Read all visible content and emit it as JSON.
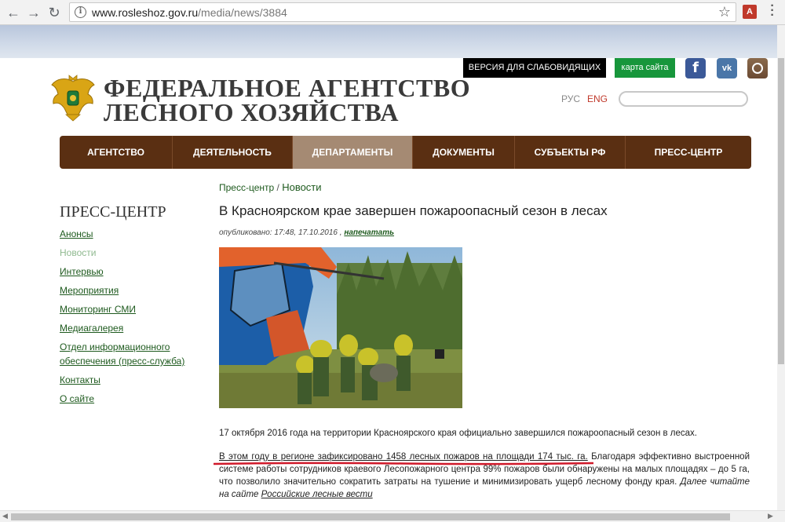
{
  "browser": {
    "url_domain": "www.rosleshoz.gov.ru",
    "url_path": "/media/news/3884",
    "back_icon": "arrow-left-icon",
    "forward_icon": "arrow-right-icon",
    "reload_icon": "reload-icon"
  },
  "header": {
    "title_line1": "ФЕДЕРАЛЬНОЕ АГЕНТСТВО",
    "title_line2": "ЛЕСНОГО ХОЗЯЙСТВА",
    "blind_version_label": "ВЕРСИЯ ДЛЯ СЛАБОВИДЯЩИХ",
    "sitemap_label": "карта сайта",
    "lang_ru": "РУС",
    "lang_en": "ENG",
    "search_placeholder": "",
    "social": [
      "facebook-icon",
      "vk-icon",
      "instagram-icon"
    ],
    "colors": {
      "nav_bg": "#5a2f12",
      "nav_active": "#a58a73",
      "sitemap_bg": "#17963b",
      "link": "#1e5a1e"
    }
  },
  "nav": {
    "items": [
      {
        "label": "АГЕНТСТВО"
      },
      {
        "label": "ДЕЯТЕЛЬНОСТЬ"
      },
      {
        "label": "ДЕПАРТАМЕНТЫ"
      },
      {
        "label": "ДОКУМЕНТЫ"
      },
      {
        "label": "СУБЪЕКТЫ РФ"
      },
      {
        "label": "ПРЕСС-ЦЕНТР"
      }
    ],
    "active_index": 2
  },
  "sidebar": {
    "title": "ПРЕСС-ЦЕНТР",
    "items": [
      {
        "label": "Анонсы"
      },
      {
        "label": "Новости"
      },
      {
        "label": "Интервью"
      },
      {
        "label": "Мероприятия"
      },
      {
        "label": "Мониторинг СМИ"
      },
      {
        "label": "Медиагалерея"
      },
      {
        "label": "Отдел информационного обеспечения (пресс-служба)"
      },
      {
        "label": "Контакты"
      },
      {
        "label": "О сайте"
      }
    ],
    "current_index": 1
  },
  "article": {
    "breadcrumb_parent": "Пресс-центр",
    "breadcrumb_sep": " / ",
    "breadcrumb_current": "Новости",
    "title": "В Красноярском крае завершен пожароопасный сезон в лесах",
    "published": "опубликовано: 17:48, 17.10.2016 , ",
    "print_label": "напечатать",
    "para1": "17 октября 2016 года на территории Красноярского края официально завершился пожароопасный сезон в лесах.",
    "para2_highlight": "В этом году в регионе зафиксировано 1458 лесных пожаров на площади 174 тыс. га.",
    "para2_rest": " Благодаря эффективно выстроенной системе работы сотрудников краевого Лесопожарного центра 99% пожаров были обнаружены на малых площадях – до 5 га, что позволило значительно сократить затраты на тушение и минимизировать ущерб лесному фонду края. ",
    "para2_more": "Далее читайте на сайте ",
    "para2_source": "Российские лесные вести"
  }
}
